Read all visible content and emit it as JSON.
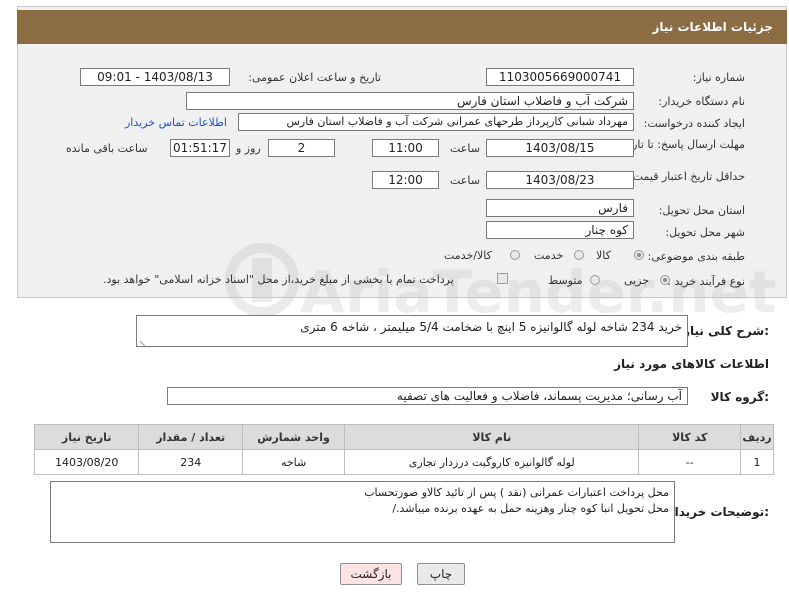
{
  "header": {
    "title": "جزئیات اطلاعات نیاز"
  },
  "fields": {
    "need_number": {
      "label": "شماره نیاز:",
      "value": "1103005669000741"
    },
    "announce_datetime": {
      "label": "تاریخ و ساعت اعلان عمومی:",
      "value": "1403/08/13 - 09:01"
    },
    "buyer_org": {
      "label": "نام دستگاه خریدار:",
      "value": "شرکت آب و فاضلاب استان فارس"
    },
    "requester": {
      "label": "ایجاد کننده درخواست:",
      "value": "مهرداد شبانی کارپرداز طرحهای عمرانی  شرکت آب و فاضلاب استان فارس",
      "contact_link": "اطلاعات تماس خریدار"
    },
    "reply_deadline": {
      "label": "مهلت ارسال پاسخ: تا تاریخ:",
      "date": "1403/08/15",
      "time_label": "ساعت",
      "time": "11:00",
      "days": "2",
      "days_label": "روز و",
      "remaining": "01:51:17",
      "remaining_label": "ساعت باقی مانده"
    },
    "price_validity": {
      "label": "حداقل تاریخ اعتبار قیمت: تا تاریخ:",
      "date": "1403/08/23",
      "time_label": "ساعت",
      "time": "12:00"
    },
    "delivery_province": {
      "label": "استان محل تحویل:",
      "value": "فارس"
    },
    "delivery_city": {
      "label": "شهر محل تحویل:",
      "value": "کوه چنار"
    },
    "category": {
      "label": "طبقه بندی موضوعی:",
      "options": [
        "کالا",
        "خدمت",
        "کالا/خدمت"
      ],
      "selected": "کالا"
    },
    "purchase_type": {
      "label": "نوع فرآیند خرید :",
      "options": [
        "جزیی",
        "متوسط"
      ],
      "selected": "جزیی",
      "payment_note": "پرداخت تمام یا بخشی از مبلغ خرید،از محل \"اسناد خزانه اسلامی\" خواهد بود."
    }
  },
  "summary": {
    "label": "شرح کلی نیاز:",
    "value": "خرید 234 شاخه لوله گالوانیزه  5 اینچ با ضخامت 5/4 میلیمتر ، شاخه 6 متری"
  },
  "goods_section": {
    "title": "اطلاعات کالاهای مورد نیاز",
    "group_label": "گروه کالا:",
    "group_value": "آب رسانی؛ مدیریت پسماند، فاضلاب و فعالیت های تصفیه"
  },
  "table": {
    "headers": [
      "ردیف",
      "کد کالا",
      "نام کالا",
      "واحد شمارش",
      "تعداد / مقدار",
      "تاریخ نیاز"
    ],
    "rows": [
      [
        "1",
        "--",
        "لوله گالوانیزه کاروگیت درزدار تجاری",
        "شاخه",
        "234",
        "1403/08/20"
      ]
    ]
  },
  "buyer_notes": {
    "label": "توضیحات خریدار:",
    "lines": [
      "محل پرداخت اعتبارات عمرانی (نقد ) پس از تائید کالاو صورتحساب",
      "محل تحویل انبا کوه چنار  وهزینه حمل به عهده برنده میباشد./"
    ]
  },
  "buttons": {
    "print": "چاپ",
    "back": "بازگشت"
  },
  "watermark": "AriaTender.net",
  "colors": {
    "header_bg": "#8b6c43",
    "link": "#1a55c9",
    "back_button_bg": "#fde4e4"
  }
}
